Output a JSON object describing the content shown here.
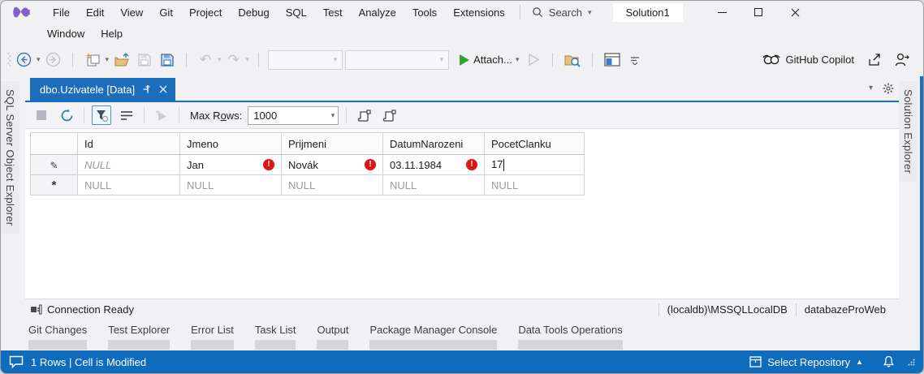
{
  "titlebar": {
    "search_label": "Search",
    "solution": "Solution1"
  },
  "menu": {
    "row1": [
      "File",
      "Edit",
      "View",
      "Git",
      "Project",
      "Debug",
      "SQL",
      "Test",
      "Analyze",
      "Tools",
      "Extensions"
    ],
    "row2": [
      "Window",
      "Help"
    ]
  },
  "toolbar": {
    "attach_label": "Attach...",
    "copilot_label": "GitHub Copilot"
  },
  "editor": {
    "tab_title": "dbo.Uzivatele [Data]",
    "grid_toolbar": {
      "max_rows_prefix": "Max R",
      "max_rows_accel": "o",
      "max_rows_suffix": "ws:",
      "max_rows_value": "1000"
    },
    "grid": {
      "columns": [
        "Id",
        "Jmeno",
        "Prijmeni",
        "DatumNarozeni",
        "PocetClanku"
      ],
      "rows": [
        {
          "cells": [
            "NULL",
            "Jan",
            "Novák",
            "03.11.1984",
            "17"
          ]
        },
        {
          "cells": [
            "NULL",
            "NULL",
            "NULL",
            "NULL",
            "NULL"
          ]
        }
      ]
    },
    "conn": {
      "status": "Connection Ready",
      "server": "(localdb)\\MSSQLLocalDB",
      "database": "databazeProWeb"
    }
  },
  "panel_tabs": [
    "Git Changes",
    "Test Explorer",
    "Error List",
    "Task List",
    "Output",
    "Package Manager Console",
    "Data Tools Operations"
  ],
  "statusbar": {
    "left": "1 Rows | Cell is Modified",
    "repo": "Select Repository"
  },
  "side": {
    "left": "SQL Server Object Explorer",
    "right": "Solution Explorer"
  },
  "icons": {
    "caret_down": "▾",
    "caret_up": "▲",
    "undo": "↶",
    "redo": "↷",
    "pencil": "✎",
    "asterisk": "*",
    "error": "!"
  },
  "colors": {
    "accent_blue": "#1c6ebd",
    "statusbar_blue": "#0f6cbd",
    "error_red": "#e11414",
    "run_green": "#31a531",
    "logo_purple": "#8661c5"
  }
}
